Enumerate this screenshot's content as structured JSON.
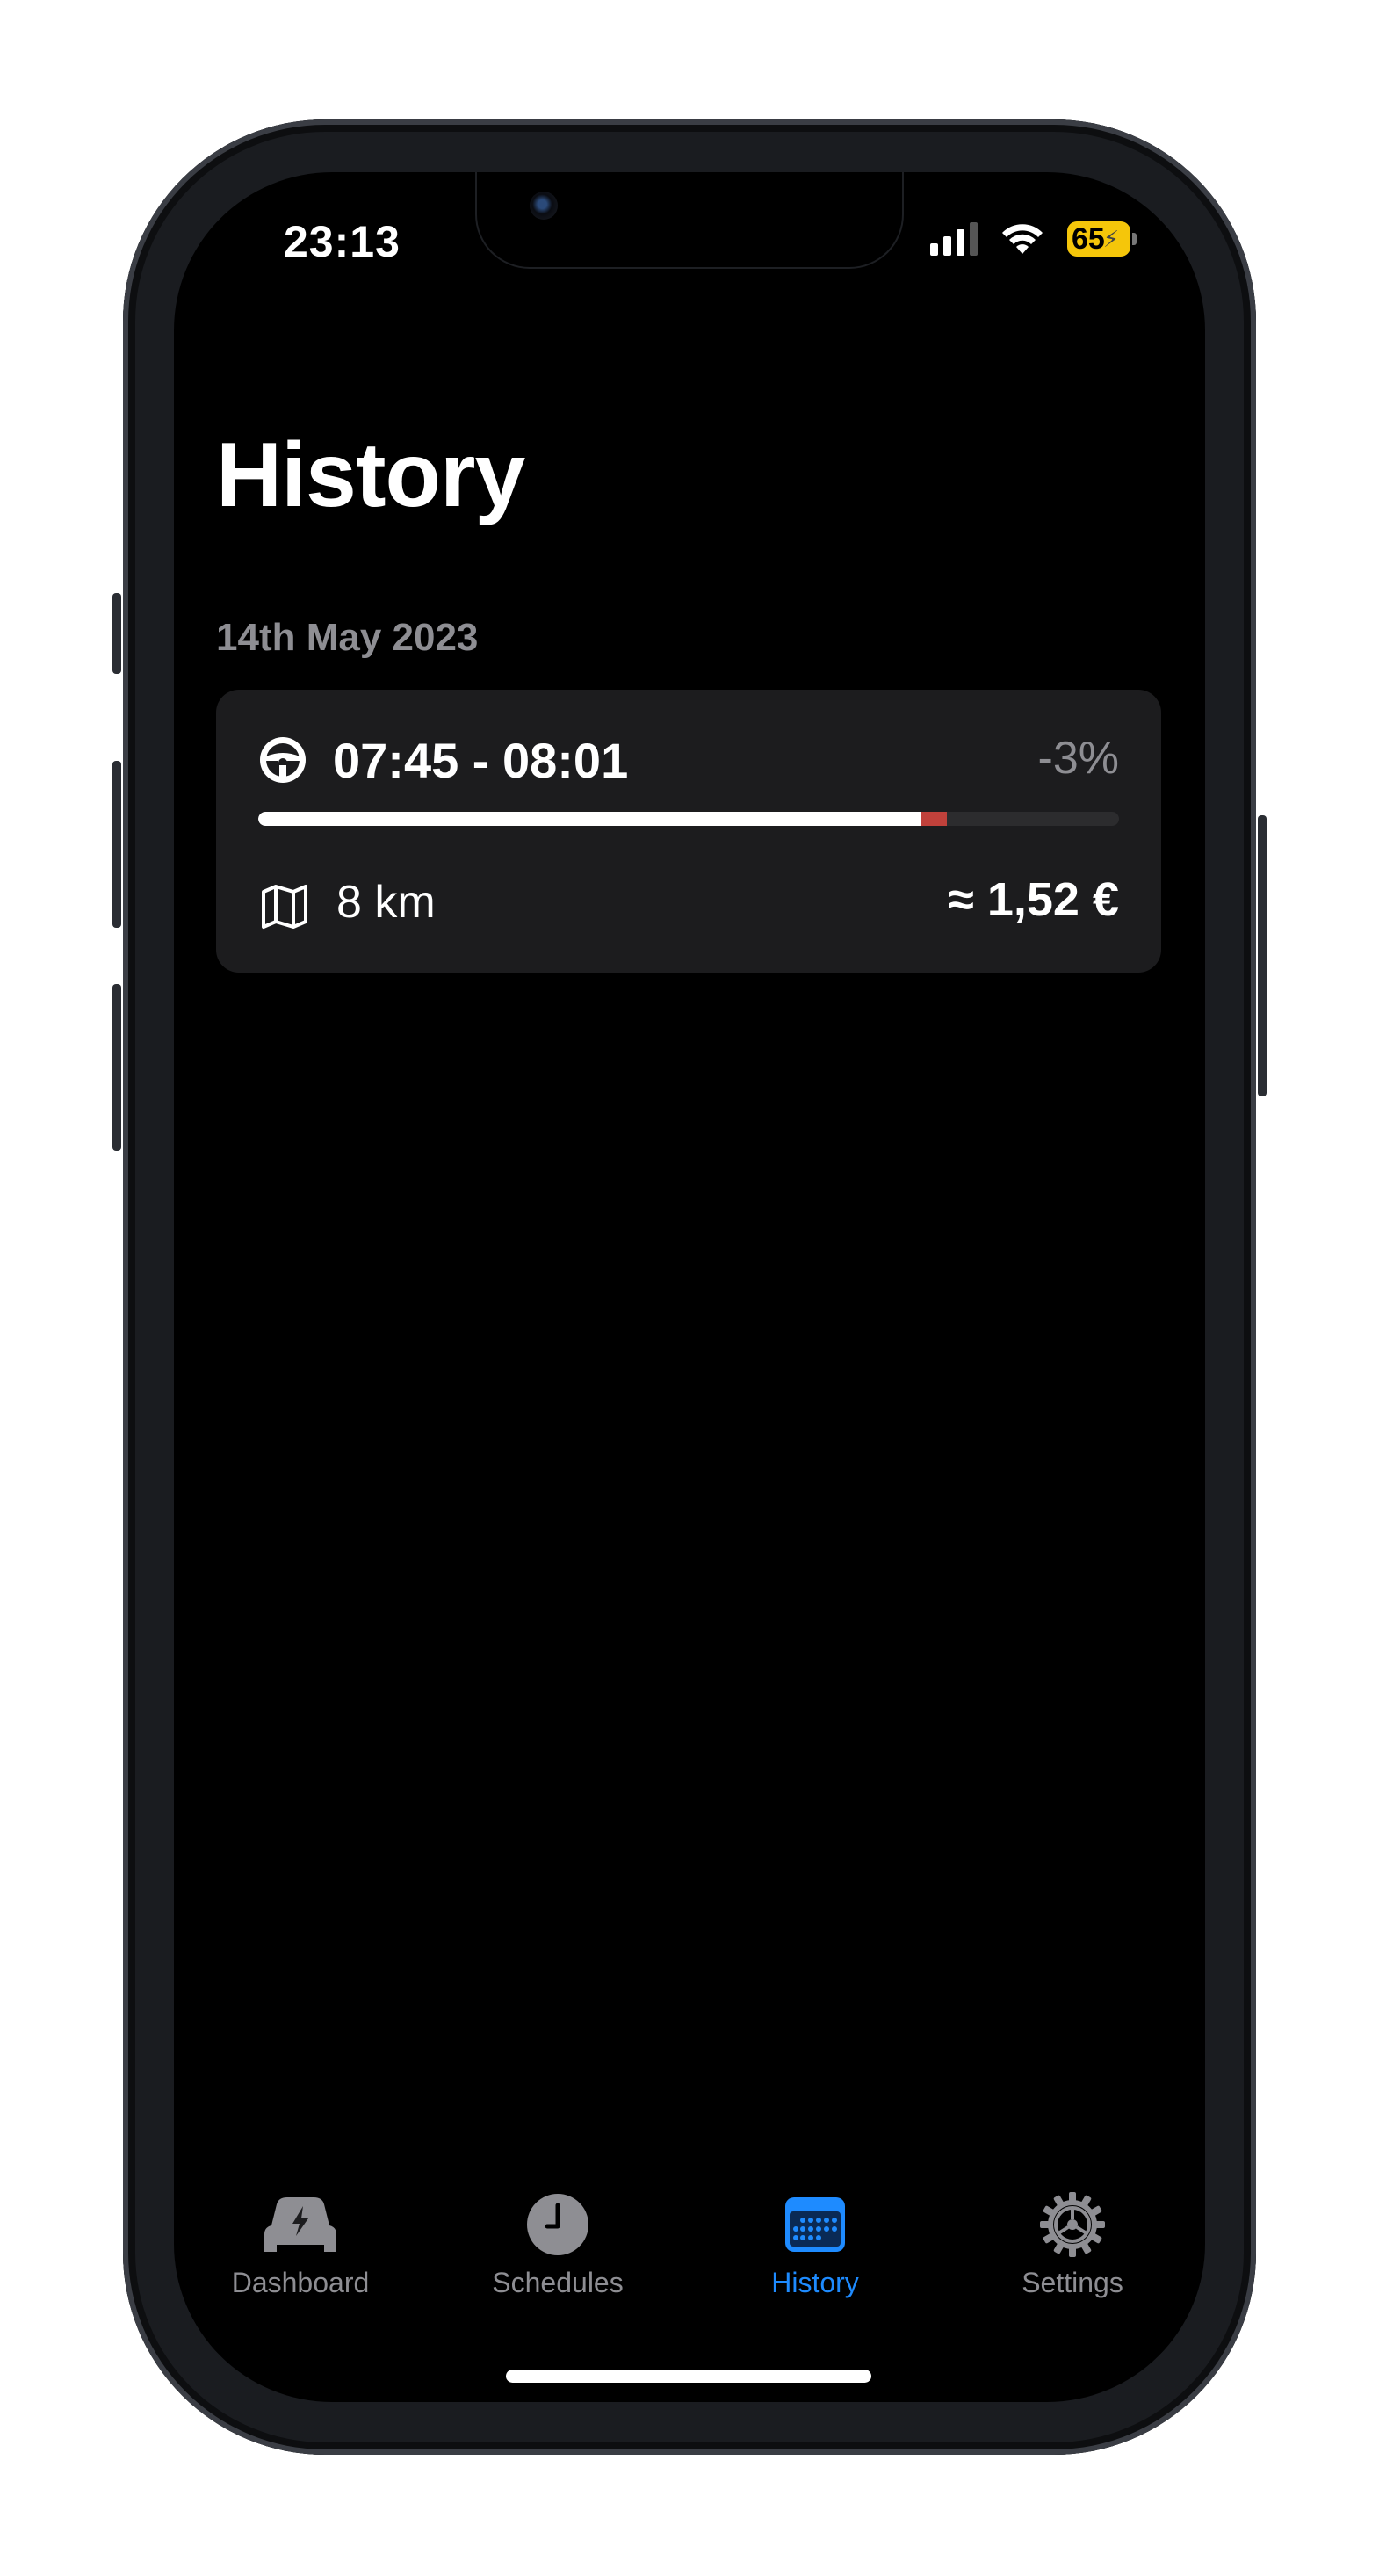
{
  "status_bar": {
    "time": "23:13",
    "battery_level": "65",
    "battery_color": "#f5c60a"
  },
  "page": {
    "title": "History"
  },
  "sections": [
    {
      "date": "14th May 2023",
      "trips": [
        {
          "time_range": "07:45 - 08:01",
          "battery_change": "-3%",
          "battery_end_fraction": 0.77,
          "battery_start_fraction": 0.8,
          "distance": "8 km",
          "cost": "≈ 1,52 €",
          "icons": {
            "trip": "steering-wheel-icon",
            "distance": "map-icon"
          }
        }
      ]
    }
  ],
  "tab_bar": {
    "accent_color": "#1e8bff",
    "items": [
      {
        "label": "Dashboard",
        "icon": "car-bolt-icon",
        "active": false
      },
      {
        "label": "Schedules",
        "icon": "clock-icon",
        "active": false
      },
      {
        "label": "History",
        "icon": "calendar-icon",
        "active": true
      },
      {
        "label": "Settings",
        "icon": "gear-icon",
        "active": false
      }
    ]
  }
}
